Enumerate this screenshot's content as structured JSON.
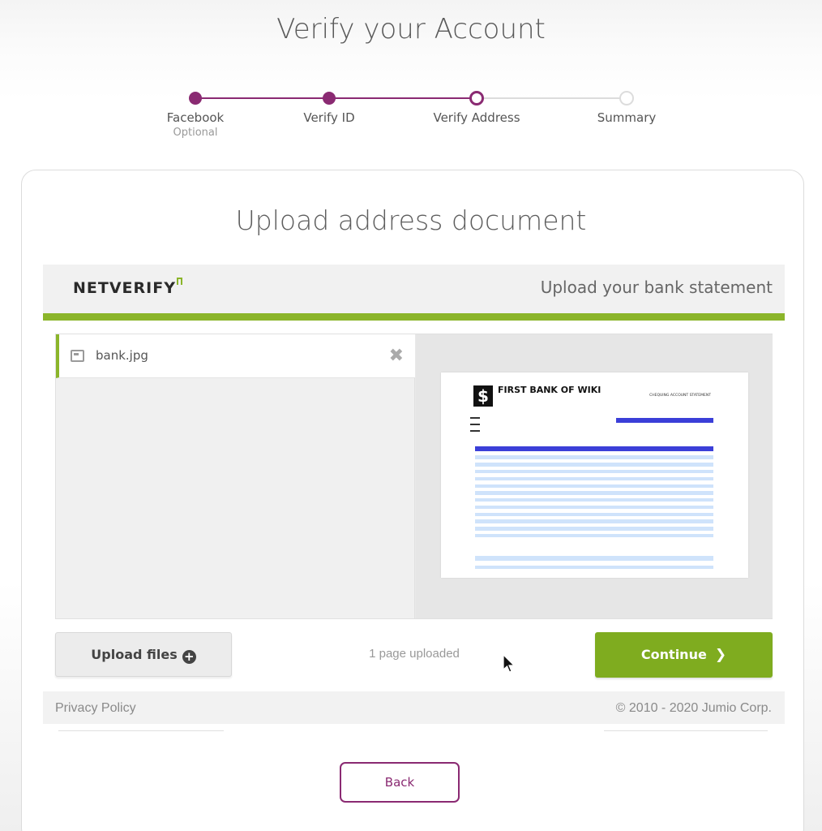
{
  "page": {
    "title": "Verify your Account"
  },
  "stepper": {
    "steps": [
      {
        "label": "Facebook",
        "sublabel": "Optional",
        "state": "done"
      },
      {
        "label": "Verify ID",
        "sublabel": "",
        "state": "done"
      },
      {
        "label": "Verify Address",
        "sublabel": "",
        "state": "current"
      },
      {
        "label": "Summary",
        "sublabel": "",
        "state": "todo"
      }
    ],
    "accent_color": "#8a2a72"
  },
  "card": {
    "title": "Upload address document"
  },
  "netverify": {
    "logo": "NETVERIFY",
    "header_text": "Upload your bank statement",
    "brand_color": "#8bb52a",
    "file": {
      "name": "bank.jpg",
      "icon": "image-file-icon",
      "remove_icon": "close-icon"
    },
    "preview": {
      "bank_name": "FIRST BANK OF WIKI",
      "statement_type": "CHEQUING ACCOUNT STATEMENT"
    },
    "upload_label": "Upload files",
    "status_text": "1 page uploaded",
    "continue_label": "Continue",
    "privacy_label": "Privacy Policy",
    "copyright": "© 2010 - 2020 Jumio Corp."
  },
  "back_label": "Back"
}
